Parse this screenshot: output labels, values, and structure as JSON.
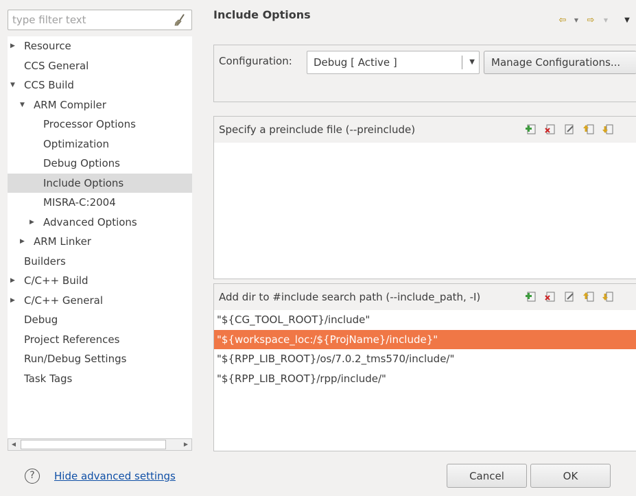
{
  "filter": {
    "placeholder": "type filter text",
    "icon": "broom-icon"
  },
  "tree": [
    {
      "label": "Resource",
      "arrow": "right"
    },
    {
      "label": "CCS General"
    },
    {
      "label": "CCS Build",
      "arrow": "down"
    },
    {
      "label": "ARM Compiler",
      "arrow": "down"
    },
    {
      "label": "Processor Options"
    },
    {
      "label": "Optimization"
    },
    {
      "label": "Debug Options"
    },
    {
      "label": "Include Options",
      "selected": true
    },
    {
      "label": "MISRA-C:2004"
    },
    {
      "label": "Advanced Options",
      "arrow": "right"
    },
    {
      "label": "ARM Linker",
      "arrow": "right"
    },
    {
      "label": "Builders"
    },
    {
      "label": "C/C++ Build",
      "arrow": "right"
    },
    {
      "label": "C/C++ General",
      "arrow": "right"
    },
    {
      "label": "Debug"
    },
    {
      "label": "Project References"
    },
    {
      "label": "Run/Debug Settings"
    },
    {
      "label": "Task Tags"
    }
  ],
  "page": {
    "title": "Include Options"
  },
  "config": {
    "label": "Configuration:",
    "selected": "Debug  [ Active ]",
    "manage_label": "Manage Configurations..."
  },
  "preinclude": {
    "header": "Specify a preinclude file (--preinclude)",
    "items": []
  },
  "include_paths": {
    "header": "Add dir to #include search path (--include_path, -I)",
    "items": [
      "\"${CG_TOOL_ROOT}/include\"",
      "\"${workspace_loc:/${ProjName}/include}\"",
      "\"${RPP_LIB_ROOT}/os/7.0.2_tms570/include/\"",
      "\"${RPP_LIB_ROOT}/rpp/include/\""
    ],
    "selected_index": 1
  },
  "footer": {
    "help_link": "Hide advanced settings",
    "cancel_label": "Cancel",
    "ok_label": "OK"
  },
  "colors": {
    "selection": "#f07746",
    "tree_selection": "#dcdcdc",
    "link": "#0f4fa6",
    "nav_arrow": "#b68a00"
  }
}
